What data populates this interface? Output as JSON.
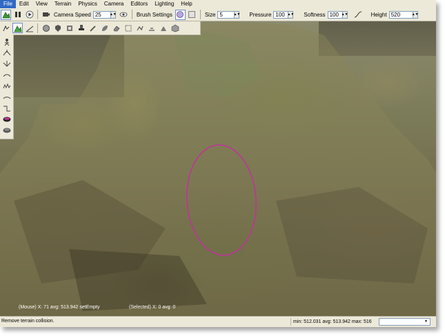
{
  "menu": [
    "File",
    "Edit",
    "View",
    "Terrain",
    "Physics",
    "Camera",
    "Editors",
    "Lighting",
    "Help"
  ],
  "toolbar": {
    "camera_speed_label": "Camera Speed",
    "camera_speed_value": "25",
    "brush_settings_label": "Brush Settings",
    "size_label": "Size",
    "size_value": "5",
    "pressure_label": "Pressure",
    "pressure_value": "100",
    "softness_label": "Softness",
    "softness_value": "100",
    "height_label": "Height",
    "height_value": "520"
  },
  "viewport": {
    "mouse_status": "(Mouse) X: 71  avg: 513.942 setEmpty",
    "selected_status": "(Selected) X: 0  avg: 0",
    "brush_color": "#c0339a"
  },
  "statusbar": {
    "message": "Remove terrain collision.",
    "stats": "min: 512.031  avg: 513.942  max: 516",
    "dropdown_value": ""
  },
  "colors": {
    "chrome": "#ece9d8",
    "accent": "#316ac5",
    "brush": "#c0339a"
  }
}
